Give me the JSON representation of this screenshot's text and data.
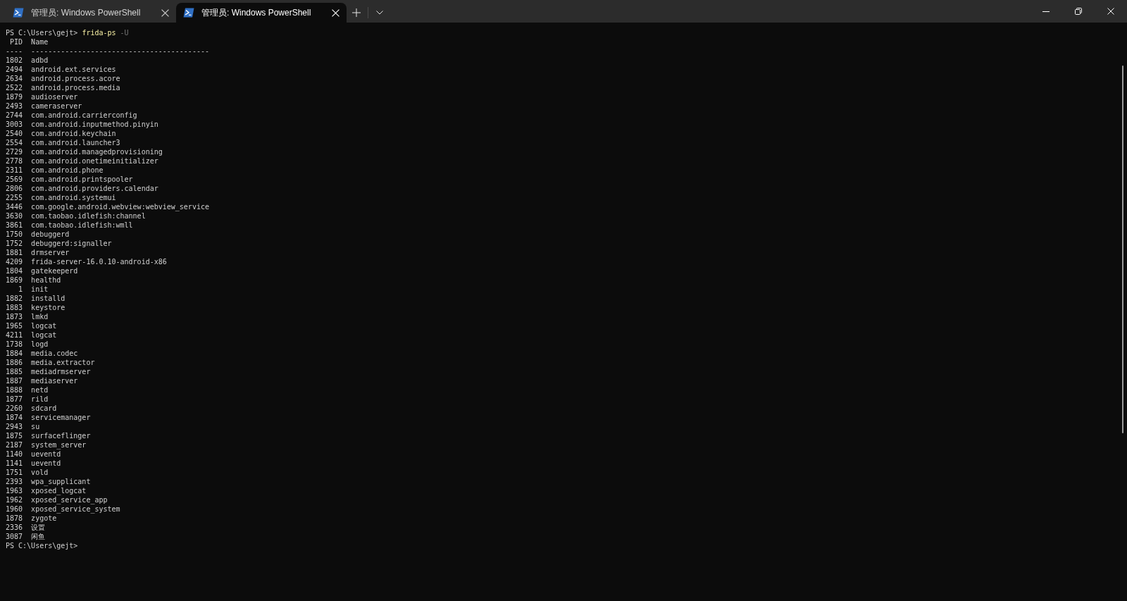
{
  "window": {
    "tabs": [
      {
        "title": "管理员: Windows PowerShell",
        "selected": false
      },
      {
        "title": "管理员: Windows PowerShell",
        "selected": true
      }
    ]
  },
  "terminal": {
    "command_line": {
      "prompt": "PS C:\\Users\\gejt>",
      "command": "frida-ps",
      "argument": "-U"
    },
    "columns": [
      {
        "heading": "PID",
        "rule": "----"
      },
      {
        "heading": "Name",
        "rule": "------------------------------------------"
      }
    ],
    "rows": [
      {
        "pid": "1802",
        "name": "adbd"
      },
      {
        "pid": "2494",
        "name": "android.ext.services"
      },
      {
        "pid": "2634",
        "name": "android.process.acore"
      },
      {
        "pid": "2522",
        "name": "android.process.media"
      },
      {
        "pid": "1879",
        "name": "audioserver"
      },
      {
        "pid": "2493",
        "name": "cameraserver"
      },
      {
        "pid": "2744",
        "name": "com.android.carrierconfig"
      },
      {
        "pid": "3003",
        "name": "com.android.inputmethod.pinyin"
      },
      {
        "pid": "2540",
        "name": "com.android.keychain"
      },
      {
        "pid": "2554",
        "name": "com.android.launcher3"
      },
      {
        "pid": "2729",
        "name": "com.android.managedprovisioning"
      },
      {
        "pid": "2778",
        "name": "com.android.onetimeinitializer"
      },
      {
        "pid": "2311",
        "name": "com.android.phone"
      },
      {
        "pid": "2569",
        "name": "com.android.printspooler"
      },
      {
        "pid": "2806",
        "name": "com.android.providers.calendar"
      },
      {
        "pid": "2255",
        "name": "com.android.systemui"
      },
      {
        "pid": "3446",
        "name": "com.google.android.webview:webview_service"
      },
      {
        "pid": "3630",
        "name": "com.taobao.idlefish:channel"
      },
      {
        "pid": "3861",
        "name": "com.taobao.idlefish:wmll"
      },
      {
        "pid": "1750",
        "name": "debuggerd"
      },
      {
        "pid": "1752",
        "name": "debuggerd:signaller"
      },
      {
        "pid": "1881",
        "name": "drmserver"
      },
      {
        "pid": "4209",
        "name": "frida-server-16.0.10-android-x86"
      },
      {
        "pid": "1804",
        "name": "gatekeeperd"
      },
      {
        "pid": "1869",
        "name": "healthd"
      },
      {
        "pid": "1",
        "name": "init"
      },
      {
        "pid": "1882",
        "name": "installd"
      },
      {
        "pid": "1883",
        "name": "keystore"
      },
      {
        "pid": "1873",
        "name": "lmkd"
      },
      {
        "pid": "1965",
        "name": "logcat"
      },
      {
        "pid": "4211",
        "name": "logcat"
      },
      {
        "pid": "1738",
        "name": "logd"
      },
      {
        "pid": "1884",
        "name": "media.codec"
      },
      {
        "pid": "1886",
        "name": "media.extractor"
      },
      {
        "pid": "1885",
        "name": "mediadrmserver"
      },
      {
        "pid": "1887",
        "name": "mediaserver"
      },
      {
        "pid": "1888",
        "name": "netd"
      },
      {
        "pid": "1877",
        "name": "rild"
      },
      {
        "pid": "2260",
        "name": "sdcard"
      },
      {
        "pid": "1874",
        "name": "servicemanager"
      },
      {
        "pid": "2943",
        "name": "su"
      },
      {
        "pid": "1875",
        "name": "surfaceflinger"
      },
      {
        "pid": "2187",
        "name": "system_server"
      },
      {
        "pid": "1140",
        "name": "ueventd"
      },
      {
        "pid": "1141",
        "name": "ueventd"
      },
      {
        "pid": "1751",
        "name": "vold"
      },
      {
        "pid": "2393",
        "name": "wpa_supplicant"
      },
      {
        "pid": "1963",
        "name": "xposed_logcat"
      },
      {
        "pid": "1962",
        "name": "xposed_service_app"
      },
      {
        "pid": "1960",
        "name": "xposed_service_system"
      },
      {
        "pid": "1878",
        "name": "zygote"
      },
      {
        "pid": "2336",
        "name": "设置"
      },
      {
        "pid": "3087",
        "name": "闲鱼"
      }
    ],
    "final_prompt": "PS C:\\Users\\gejt>"
  }
}
